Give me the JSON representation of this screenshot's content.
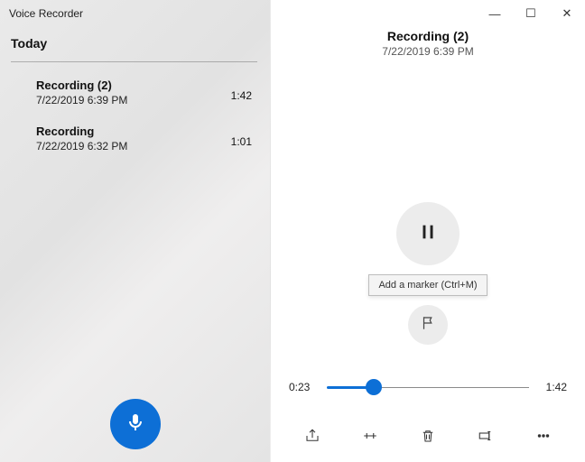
{
  "app": {
    "title": "Voice Recorder"
  },
  "sidebar": {
    "section_label": "Today",
    "recordings": [
      {
        "name": "Recording (2)",
        "date": "7/22/2019 6:39 PM",
        "duration": "1:42"
      },
      {
        "name": "Recording",
        "date": "7/22/2019 6:32 PM",
        "duration": "1:01"
      }
    ]
  },
  "main": {
    "title": "Recording (2)",
    "subtitle": "7/22/2019 6:39 PM",
    "tooltip": "Add a marker (Ctrl+M)",
    "progress": {
      "current": "0:23",
      "total": "1:42",
      "percent": 23
    }
  },
  "window_controls": {
    "min": "—",
    "max": "☐",
    "close": "✕"
  }
}
